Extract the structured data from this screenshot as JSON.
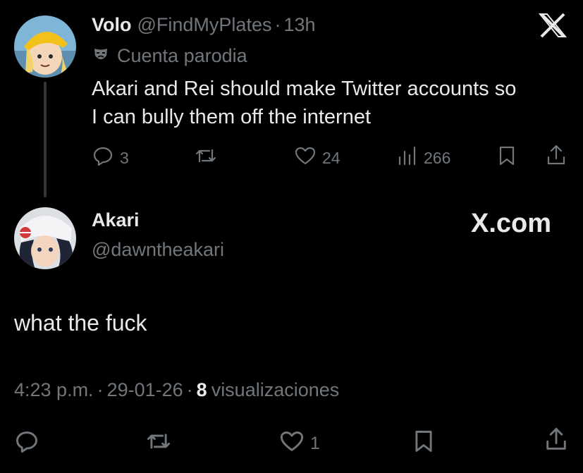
{
  "quoted_post": {
    "display_name": "Volo",
    "handle": "@FindMyPlates",
    "separator": "·",
    "time": "13h",
    "badge_label": "Cuenta parodia",
    "text_line1": "Akari and Rei should make Twitter accounts so",
    "text_line2": "I can bully them off the internet",
    "replies": "3",
    "likes": "24",
    "views": "266",
    "x_logo": "X"
  },
  "main_post": {
    "display_name": "Akari",
    "handle": "@dawntheakari",
    "brand": "X.com",
    "text": "what the fuck",
    "time": "4:23 p.m.",
    "dot1": "·",
    "date": "29-01-26",
    "dot2": "·",
    "views_count": "8",
    "views_label": "visualizaciones",
    "likes": "1"
  },
  "colors": {
    "background": "#000000",
    "text_primary": "#e7e9ea",
    "text_secondary": "#71767b",
    "thread_line": "#333639"
  },
  "icons": [
    "x-logo-icon",
    "parody-mask-icon",
    "reply-icon",
    "repost-icon",
    "like-icon",
    "views-icon",
    "bookmark-icon",
    "share-icon"
  ]
}
